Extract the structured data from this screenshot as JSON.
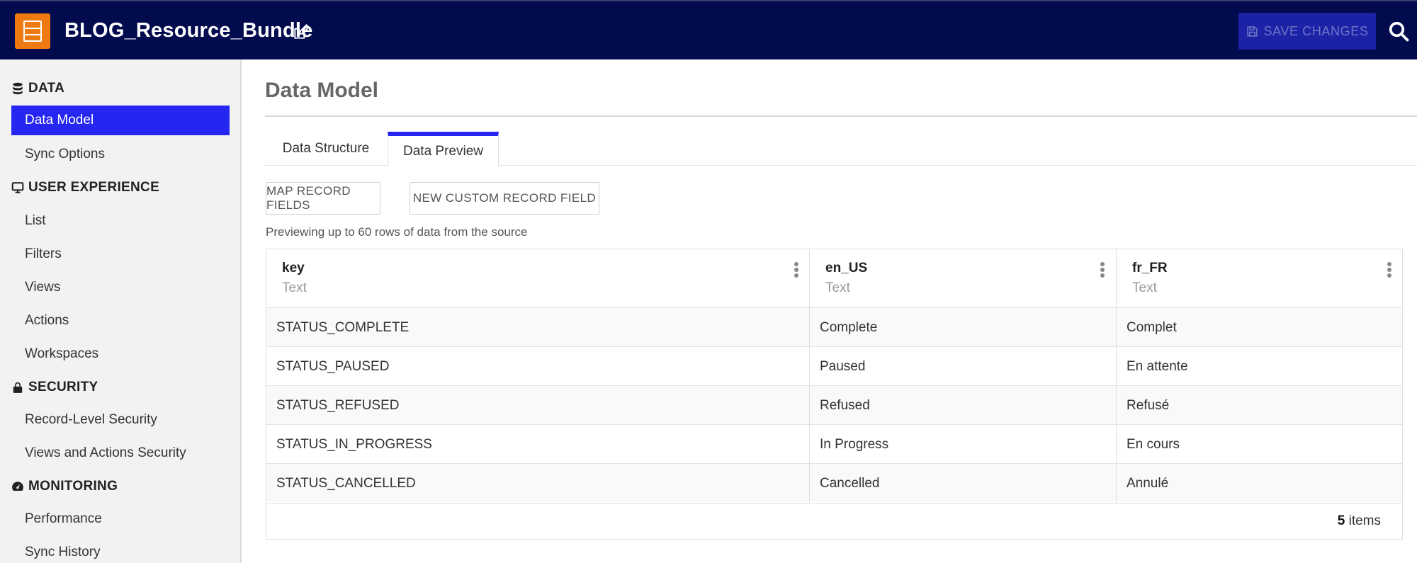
{
  "header": {
    "app_title": "BLOG_Resource_Bundle",
    "save_label": "SAVE CHANGES",
    "bg_color": "#020b4e",
    "app_icon_color": "#f07a12"
  },
  "sidebar": {
    "sections": [
      {
        "label": "DATA",
        "icon": "database-icon",
        "items": [
          {
            "label": "Data Model",
            "active": true
          },
          {
            "label": "Sync Options"
          }
        ]
      },
      {
        "label": "USER EXPERIENCE",
        "icon": "monitor-icon",
        "items": [
          {
            "label": "List"
          },
          {
            "label": "Filters"
          },
          {
            "label": "Views"
          },
          {
            "label": "Actions"
          },
          {
            "label": "Workspaces"
          }
        ]
      },
      {
        "label": "SECURITY",
        "icon": "lock-icon",
        "items": [
          {
            "label": "Record-Level Security"
          },
          {
            "label": "Views and Actions Security"
          }
        ]
      },
      {
        "label": "MONITORING",
        "icon": "gauge-icon",
        "items": [
          {
            "label": "Performance"
          },
          {
            "label": "Sync History"
          }
        ]
      }
    ]
  },
  "main": {
    "title": "Data Model",
    "tabs": [
      {
        "label": "Data Structure"
      },
      {
        "label": "Data Preview",
        "active": true
      }
    ],
    "buttons": {
      "map_fields": "MAP RECORD FIELDS",
      "new_field": "NEW CUSTOM RECORD FIELD"
    },
    "preview_note": "Previewing up to 60 rows of data from the source",
    "table": {
      "columns": [
        {
          "name": "key",
          "type": "Text"
        },
        {
          "name": "en_US",
          "type": "Text"
        },
        {
          "name": "fr_FR",
          "type": "Text"
        }
      ],
      "rows": [
        [
          "STATUS_COMPLETE",
          "Complete",
          "Complet"
        ],
        [
          "STATUS_PAUSED",
          "Paused",
          "En attente"
        ],
        [
          "STATUS_REFUSED",
          "Refused",
          "Refusé"
        ],
        [
          "STATUS_IN_PROGRESS",
          "In Progress",
          "En cours"
        ],
        [
          "STATUS_CANCELLED",
          "Cancelled",
          "Annulé"
        ]
      ],
      "footer_count": "5",
      "footer_suffix": " items"
    },
    "accent_color": "#2526f2"
  }
}
